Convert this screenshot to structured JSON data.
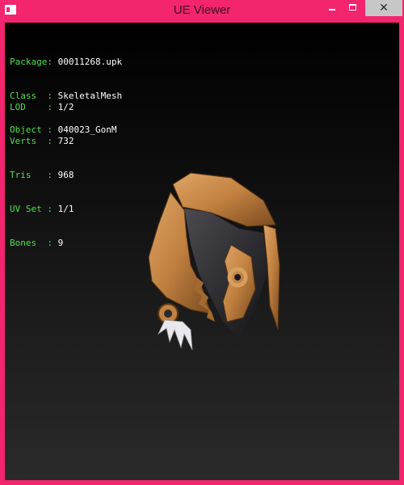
{
  "window": {
    "title": "UE Viewer",
    "close_glyph": "✕"
  },
  "info": {
    "package_label": "Package:",
    "package_value": "00011268.upk",
    "class_label": "Class  :",
    "class_value": "SkeletalMesh",
    "object_label": "Object :",
    "object_value": "040023_GonM",
    "lod_label": "LOD    :",
    "lod_value": "1/2",
    "verts_label": "Verts  :",
    "verts_value": "732",
    "tris_label": "Tris   :",
    "tris_value": "968",
    "uvset_label": "UV Set :",
    "uvset_value": "1/1",
    "bones_label": "Bones  :",
    "bones_value": "9"
  },
  "colors": {
    "frame": "#f2256e",
    "label_green": "#4fe04f",
    "value_white": "#ffffff",
    "mesh_gold": "#c98a45",
    "mesh_dark": "#2a2a2e"
  }
}
